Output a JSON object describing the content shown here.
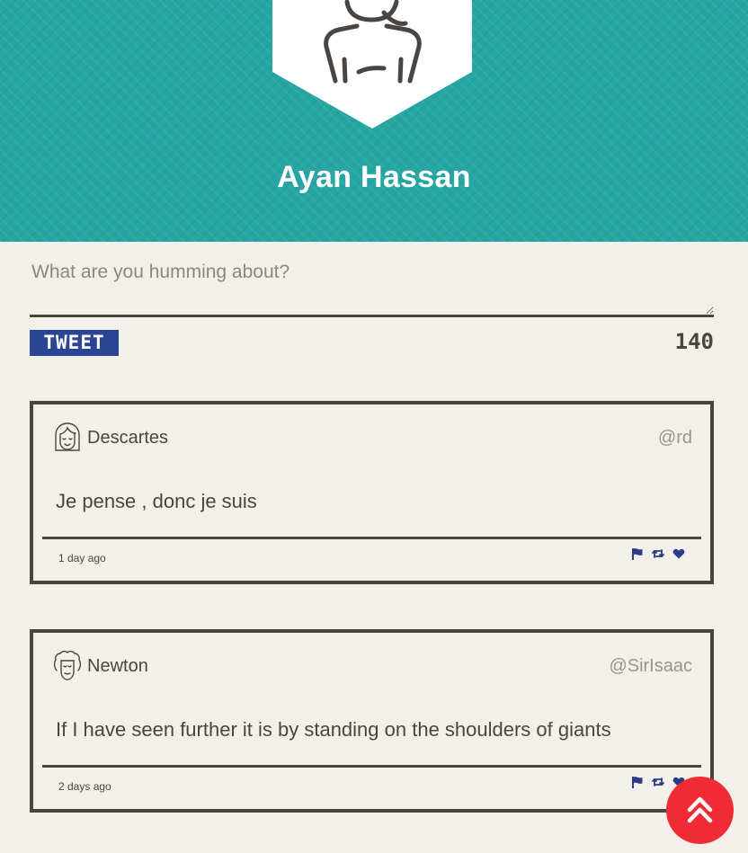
{
  "profile": {
    "name": "Ayan Hassan"
  },
  "composer": {
    "placeholder": "What are you humming about?",
    "tweet_label": "TWEET",
    "char_count": "140"
  },
  "tweets": [
    {
      "author": "Descartes",
      "handle": "@rd",
      "text": "Je pense , donc je suis",
      "time": "1 day ago"
    },
    {
      "author": "Newton",
      "handle": "@SirIsaac",
      "text": "If I have seen further it is by standing on the shoulders of giants",
      "time": "2 days ago"
    }
  ],
  "colors": {
    "hero": "#26a6a3",
    "text": "#4a4541",
    "tweet_button": "#2b4493",
    "actions": "#2b3a8a",
    "scroll_top": "#ef2b34"
  },
  "icons": {
    "profile": "user-silhouette-icon",
    "scroll_top": "double-chevron-up-icon",
    "report": "flag-icon",
    "retweet": "retweet-icon",
    "like": "heart-icon"
  }
}
